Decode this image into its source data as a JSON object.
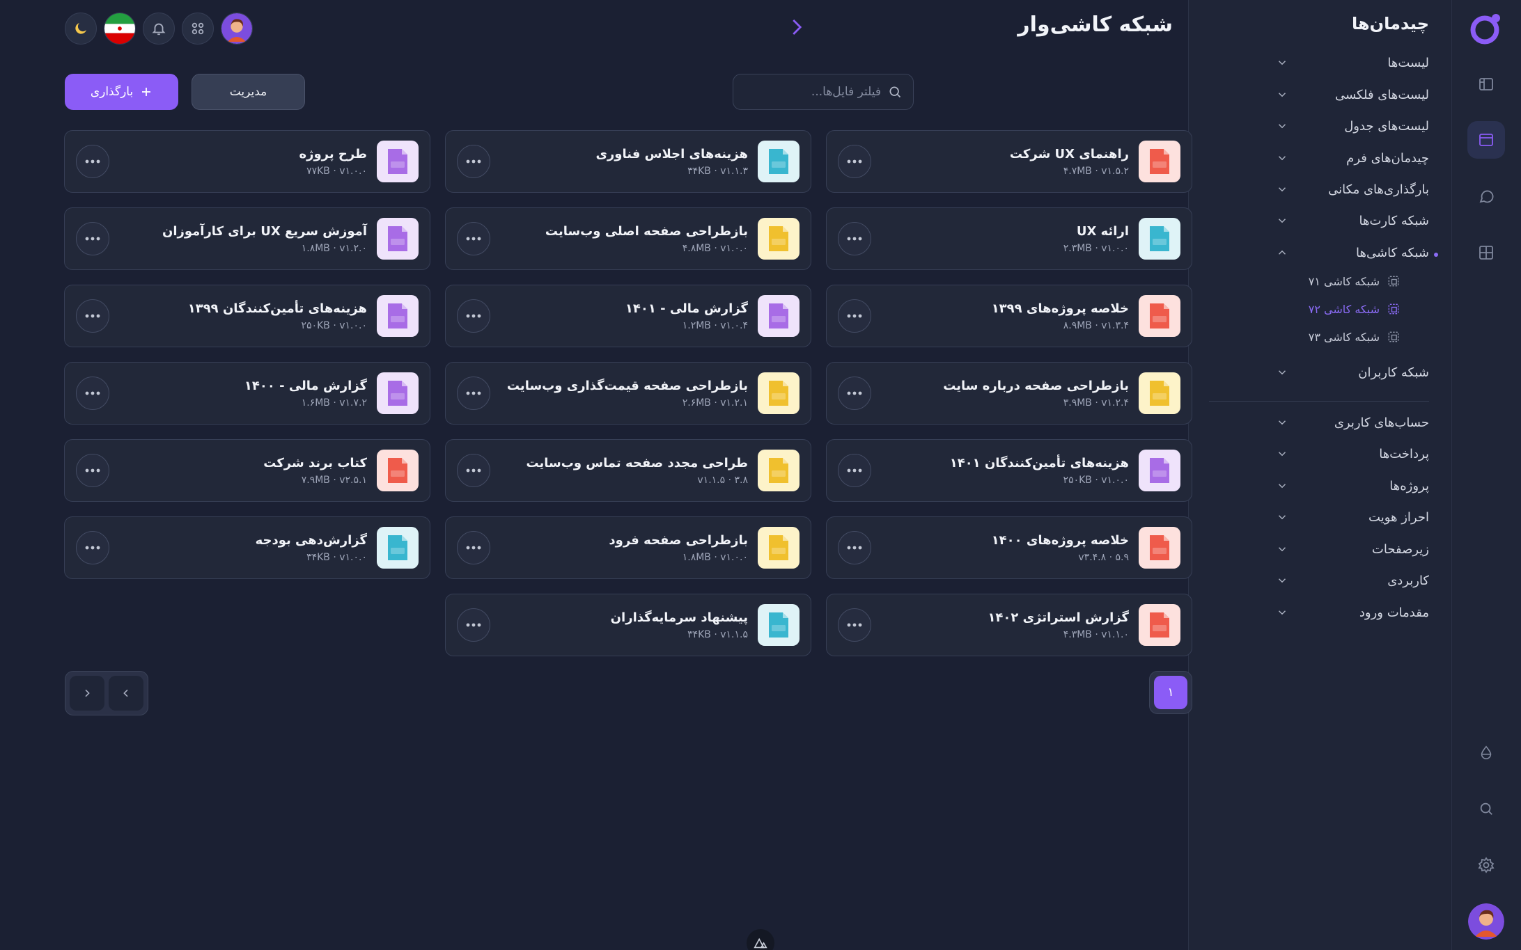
{
  "page": {
    "title": "شبکه کاشی‌وار"
  },
  "rail": {
    "icons": [
      "logo-icon",
      "layout-icon",
      "window-icon",
      "chat-icon",
      "grid-icon",
      "drop-icon",
      "search-icon",
      "gear-icon",
      "avatar"
    ]
  },
  "sidebar": {
    "title": "چیدمان‌ها",
    "items": [
      {
        "label": "لیست‌ها"
      },
      {
        "label": "لیست‌های فلکسی"
      },
      {
        "label": "لیست‌های جدول"
      },
      {
        "label": "چیدمان‌های فرم"
      },
      {
        "label": "بارگذاری‌های مکانی"
      },
      {
        "label": "شبکه کارت‌ها"
      },
      {
        "label": "شبکه کاشی‌ها"
      }
    ],
    "subitems": [
      {
        "label": "شبکه کاشی ۷۱"
      },
      {
        "label": "شبکه کاشی ۷۲"
      },
      {
        "label": "شبکه کاشی ۷۳"
      }
    ],
    "users_grid": "شبکه کاربران",
    "items2": [
      {
        "label": "حساب‌های کاربری"
      },
      {
        "label": "پرداخت‌ها"
      },
      {
        "label": "پروژه‌ها"
      },
      {
        "label": "احراز هویت"
      },
      {
        "label": "زیرصفحات"
      },
      {
        "label": "کاربردی"
      },
      {
        "label": "مقدمات ورود"
      }
    ]
  },
  "toolbar": {
    "search_placeholder": "فیلتر فایل‌ها...",
    "upload_label": "بارگذاری",
    "manage_label": "مدیریت"
  },
  "files": [
    {
      "name": "راهنمای UX شرکت",
      "meta": "۴.۷MB · v۱.۵.۲",
      "type": "PDF"
    },
    {
      "name": "هزینه‌های اجلاس فناوری",
      "meta": "۳۴KB · v۱.۱.۳",
      "type": "XLS"
    },
    {
      "name": "طرح پروژه",
      "meta": "۷۷KB · v۱.۰.۰",
      "type": "DOC"
    },
    {
      "name": "ارائه UX",
      "meta": "۲.۳MB · v۱.۰.۰",
      "type": "PPT"
    },
    {
      "name": "بازطراحی صفحه اصلی وب‌سایت",
      "meta": "۴.۸MB · v۱.۰.۰",
      "type": "AI"
    },
    {
      "name": "آموزش سریع UX برای کارآموزان",
      "meta": "۱.۸MB · v۱.۲.۰",
      "type": "DOC"
    },
    {
      "name": "خلاصه پروژه‌های ۱۳۹۹",
      "meta": "۸.۹MB · v۱.۳.۴",
      "type": "PDF"
    },
    {
      "name": "گزارش مالی - ۱۴۰۱",
      "meta": "۱.۲MB · v۱.۰.۴",
      "type": "DOC"
    },
    {
      "name": "هزینه‌های تأمین‌کنندگان ۱۳۹۹",
      "meta": "۲۵۰KB · v۱.۰.۰",
      "type": "DOC"
    },
    {
      "name": "بازطراحی صفحه درباره سایت",
      "meta": "۳.۹MB · v۱.۲.۴",
      "type": "AI"
    },
    {
      "name": "بازطراحی صفحه قیمت‌گذاری وب‌سایت",
      "meta": "۲.۶MB · v۱.۲.۱",
      "type": "AI"
    },
    {
      "name": "گزارش مالی - ۱۴۰۰",
      "meta": "۱.۶MB · v۱.۷.۲",
      "type": "DOC"
    },
    {
      "name": "هزینه‌های تأمین‌کنندگان ۱۴۰۱",
      "meta": "۲۵۰KB · v۱.۰.۰",
      "type": "DOC"
    },
    {
      "name": "طراحی مجدد صفحه تماس وب‌سایت",
      "meta": "۳.۸ · v۱.۱.۵",
      "type": "AI"
    },
    {
      "name": "کتاب برند شرکت",
      "meta": "۷.۹MB · v۲.۵.۱",
      "type": "PDF"
    },
    {
      "name": "خلاصه پروژه‌های ۱۴۰۰",
      "meta": "۵.۹ · v۳.۴.۸",
      "type": "PDF"
    },
    {
      "name": "بازطراحی صفحه فرود",
      "meta": "۱.۸MB · v۱.۰.۰",
      "type": "AI"
    },
    {
      "name": "گزارش‌دهی بودجه",
      "meta": "۳۴KB · v۱.۰.۰",
      "type": "XLS"
    },
    {
      "name": "گزارش استراتژی ۱۴۰۲",
      "meta": "۴.۳MB · v۱.۱.۰",
      "type": "PDF"
    },
    {
      "name": "پیشنهاد سرمایه‌گذاران",
      "meta": "۳۴KB · v۱.۱.۵",
      "type": "PPT"
    }
  ],
  "pagination": {
    "current": "۱"
  },
  "colors": {
    "accent": "#8b5cf6",
    "bg": "#1b2033",
    "panel": "#1f2537"
  }
}
